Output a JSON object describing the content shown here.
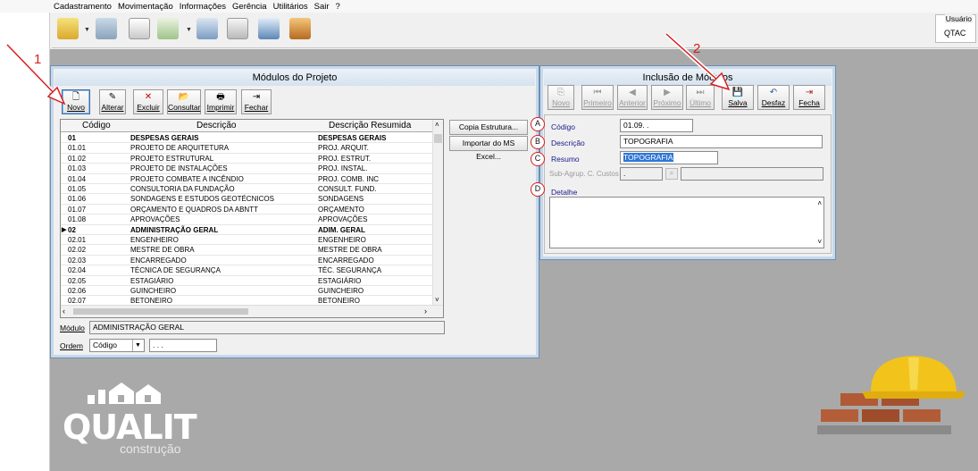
{
  "menu": [
    "Cadastramento",
    "Movimentação",
    "Informações",
    "Gerência",
    "Utilitários",
    "Sair",
    "?"
  ],
  "toolbar_icons": [
    "folder-icon",
    "tools-icon",
    "calendar-sheet-icon",
    "document-money-icon",
    "people-icon",
    "calendar-clock-icon",
    "search-people-icon",
    "exit-door-icon"
  ],
  "user": {
    "label": "Usuário",
    "value": "QTAC"
  },
  "left_window": {
    "title": "Módulos do Projeto",
    "buttons": [
      {
        "key": "novo",
        "label": "Novo",
        "icon": "new-document-icon"
      },
      {
        "key": "alterar",
        "label": "Alterar",
        "icon": "pencil-icon"
      },
      {
        "key": "excluir",
        "label": "Excluir",
        "icon": "delete-x-icon"
      },
      {
        "key": "consultar",
        "label": "Consultar",
        "icon": "open-folder-icon"
      },
      {
        "key": "imprimir",
        "label": "Imprimir",
        "icon": "printer-icon"
      },
      {
        "key": "fechar",
        "label": "Fechar",
        "icon": "exit-icon"
      }
    ],
    "columns": [
      "Código",
      "Descrição",
      "Descrição Resumida"
    ],
    "rows": [
      {
        "codigo": "01",
        "descricao": "DESPESAS GERAIS",
        "resumo": "DESPESAS GERAIS",
        "bold": true
      },
      {
        "codigo": "01.01",
        "descricao": "PROJETO DE ARQUITETURA",
        "resumo": "PROJ. ARQUIT."
      },
      {
        "codigo": "01.02",
        "descricao": "PROJETO ESTRUTURAL",
        "resumo": "PROJ. ESTRUT."
      },
      {
        "codigo": "01.03",
        "descricao": "PROJETO DE INSTALAÇÕES",
        "resumo": "PROJ. INSTAL."
      },
      {
        "codigo": "01.04",
        "descricao": "PROJETO COMBATE A INCÊNDIO",
        "resumo": "PROJ. COMB. INC"
      },
      {
        "codigo": "01.05",
        "descricao": "CONSULTORIA DA FUNDAÇÃO",
        "resumo": "CONSULT. FUND."
      },
      {
        "codigo": "01.06",
        "descricao": "SONDAGENS E ESTUDOS GEOTÉCNICOS",
        "resumo": "SONDAGENS"
      },
      {
        "codigo": "01.07",
        "descricao": "ORÇAMENTO E QUADROS DA ABNTT",
        "resumo": "ORÇAMENTO"
      },
      {
        "codigo": "01.08",
        "descricao": "APROVAÇÕES",
        "resumo": "APROVAÇÕES"
      },
      {
        "codigo": "02",
        "descricao": "ADMINISTRAÇÃO GERAL",
        "resumo": "ADIM. GERAL",
        "bold": true,
        "current": true
      },
      {
        "codigo": "02.01",
        "descricao": "ENGENHEIRO",
        "resumo": "ENGENHEIRO"
      },
      {
        "codigo": "02.02",
        "descricao": "MESTRE DE OBRA",
        "resumo": "MESTRE DE OBRA"
      },
      {
        "codigo": "02.03",
        "descricao": "ENCARREGADO",
        "resumo": "ENCARREGADO"
      },
      {
        "codigo": "02.04",
        "descricao": "TÉCNICA DE SEGURANÇA",
        "resumo": "TÉC. SEGURANÇA"
      },
      {
        "codigo": "02.05",
        "descricao": "ESTAGIÁRIO",
        "resumo": "ESTAGIÁRIO"
      },
      {
        "codigo": "02.06",
        "descricao": "GUINCHEIRO",
        "resumo": "GUINCHEIRO"
      },
      {
        "codigo": "02.07",
        "descricao": "BETONEIRO",
        "resumo": "BETONEIRO"
      }
    ],
    "side_buttons": [
      "Copia Estrutura...",
      "Importar do MS Excel..."
    ],
    "modulo_label": "Módulo",
    "modulo_value": "ADMINISTRAÇÃO GERAL",
    "ordem_label": "Ordem",
    "ordem_value": "Código",
    "ordem_extra": ". . ."
  },
  "right_window": {
    "title": "Inclusão de Módulos",
    "buttons": [
      {
        "key": "novo",
        "label": "Novo",
        "icon": "new-icon",
        "disabled": true
      },
      {
        "key": "primeiro",
        "label": "Primeiro",
        "icon": "first-record-icon",
        "disabled": true
      },
      {
        "key": "anterior",
        "label": "Anterior",
        "icon": "previous-record-icon",
        "disabled": true
      },
      {
        "key": "proximo",
        "label": "Próximo",
        "icon": "next-record-icon",
        "disabled": true
      },
      {
        "key": "ultimo",
        "label": "Último",
        "icon": "last-record-icon",
        "disabled": true
      },
      {
        "key": "salva",
        "label": "Salva",
        "icon": "save-disk-icon",
        "disabled": false
      },
      {
        "key": "desfaz",
        "label": "Desfaz",
        "icon": "undo-icon",
        "disabled": false
      },
      {
        "key": "fecha",
        "label": "Fecha",
        "icon": "close-door-icon",
        "disabled": false
      }
    ],
    "fields": {
      "codigo": {
        "label": "Código",
        "value": "01.09.  ."
      },
      "descricao": {
        "label": "Descrição",
        "value": "TOPOGRAFIA"
      },
      "resumo": {
        "label": "Resumo",
        "value": "TOPOGRAFIA"
      },
      "subagrup": {
        "label": "Sub-Agrup. C. Custos",
        "value": "  ."
      },
      "detalhe": {
        "label": "Detalhe"
      }
    }
  },
  "annotations": {
    "circles": [
      "A",
      "B",
      "C",
      "D"
    ],
    "callout_1": "1",
    "callout_2": "2"
  },
  "logo": {
    "brand": "QUALIT",
    "sub": "construção"
  }
}
